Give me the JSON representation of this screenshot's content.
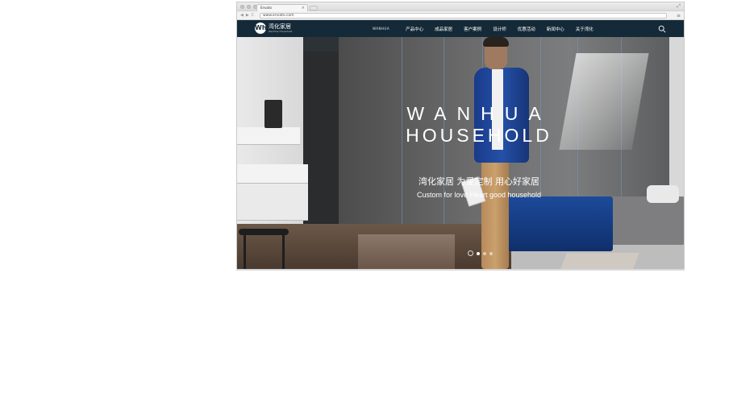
{
  "browser": {
    "tab_title": "Envato",
    "tab_close": "×",
    "url": "www.envato.com",
    "back": "◀",
    "forward": "▶",
    "reload": "C",
    "menu": "≡",
    "resize": "⤢"
  },
  "site": {
    "logo_mark": "Wh",
    "logo_cn": "湾化家居",
    "logo_en": "WanHua Household",
    "nav_brand": "WANHUA",
    "nav": [
      "产品中心",
      "成品家居",
      "客户案例",
      "设计师",
      "优惠活动",
      "新闻中心",
      "关于湾化"
    ],
    "search_icon": "search-icon"
  },
  "hero": {
    "line1": "WANHUA",
    "line2": "HOUSEHOLD",
    "sub_cn": "湾化家居 为爱定制 用心好家居",
    "sub_en": "Custom for love Heart good household",
    "slides_count": 3,
    "active_slide": 1
  },
  "colors": {
    "nav_bg": "#152a38",
    "jacket": "#2451a8",
    "bedding": "#1c4a9a"
  }
}
